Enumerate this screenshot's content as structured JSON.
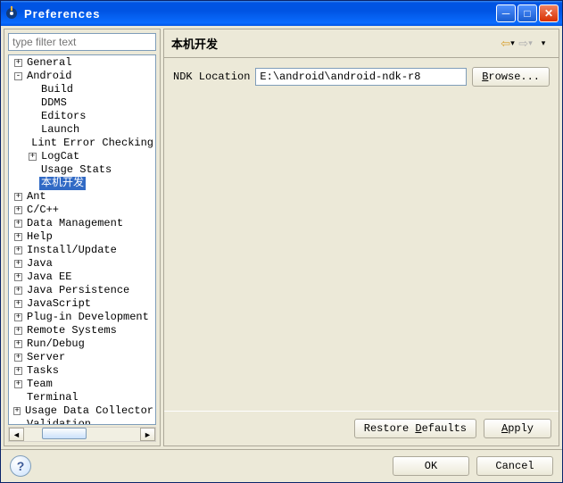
{
  "window": {
    "title": "Preferences"
  },
  "filter": {
    "placeholder": "type filter text"
  },
  "tree": [
    {
      "d": 0,
      "t": "+",
      "label": "General"
    },
    {
      "d": 0,
      "t": "-",
      "label": "Android"
    },
    {
      "d": 1,
      "t": "",
      "label": "Build"
    },
    {
      "d": 1,
      "t": "",
      "label": "DDMS"
    },
    {
      "d": 1,
      "t": "",
      "label": "Editors"
    },
    {
      "d": 1,
      "t": "",
      "label": "Launch"
    },
    {
      "d": 1,
      "t": "",
      "label": "Lint Error Checking"
    },
    {
      "d": 1,
      "t": "+",
      "label": "LogCat"
    },
    {
      "d": 1,
      "t": "",
      "label": "Usage Stats"
    },
    {
      "d": 1,
      "t": "",
      "label": "本机开发",
      "selected": true
    },
    {
      "d": 0,
      "t": "+",
      "label": "Ant"
    },
    {
      "d": 0,
      "t": "+",
      "label": "C/C++"
    },
    {
      "d": 0,
      "t": "+",
      "label": "Data Management"
    },
    {
      "d": 0,
      "t": "+",
      "label": "Help"
    },
    {
      "d": 0,
      "t": "+",
      "label": "Install/Update"
    },
    {
      "d": 0,
      "t": "+",
      "label": "Java"
    },
    {
      "d": 0,
      "t": "+",
      "label": "Java EE"
    },
    {
      "d": 0,
      "t": "+",
      "label": "Java Persistence"
    },
    {
      "d": 0,
      "t": "+",
      "label": "JavaScript"
    },
    {
      "d": 0,
      "t": "+",
      "label": "Plug-in Development"
    },
    {
      "d": 0,
      "t": "+",
      "label": "Remote Systems"
    },
    {
      "d": 0,
      "t": "+",
      "label": "Run/Debug"
    },
    {
      "d": 0,
      "t": "+",
      "label": "Server"
    },
    {
      "d": 0,
      "t": "+",
      "label": "Tasks"
    },
    {
      "d": 0,
      "t": "+",
      "label": "Team"
    },
    {
      "d": 0,
      "t": "",
      "label": "Terminal"
    },
    {
      "d": 0,
      "t": "+",
      "label": "Usage Data Collector"
    },
    {
      "d": 0,
      "t": "",
      "label": "Validation"
    }
  ],
  "page": {
    "title": "本机开发",
    "ndk_label": "NDK Location",
    "ndk_value": "E:\\android\\android-ndk-r8",
    "browse": "Browse..."
  },
  "buttons": {
    "restore": "Restore Defaults",
    "apply": "Apply",
    "ok": "OK",
    "cancel": "Cancel"
  }
}
